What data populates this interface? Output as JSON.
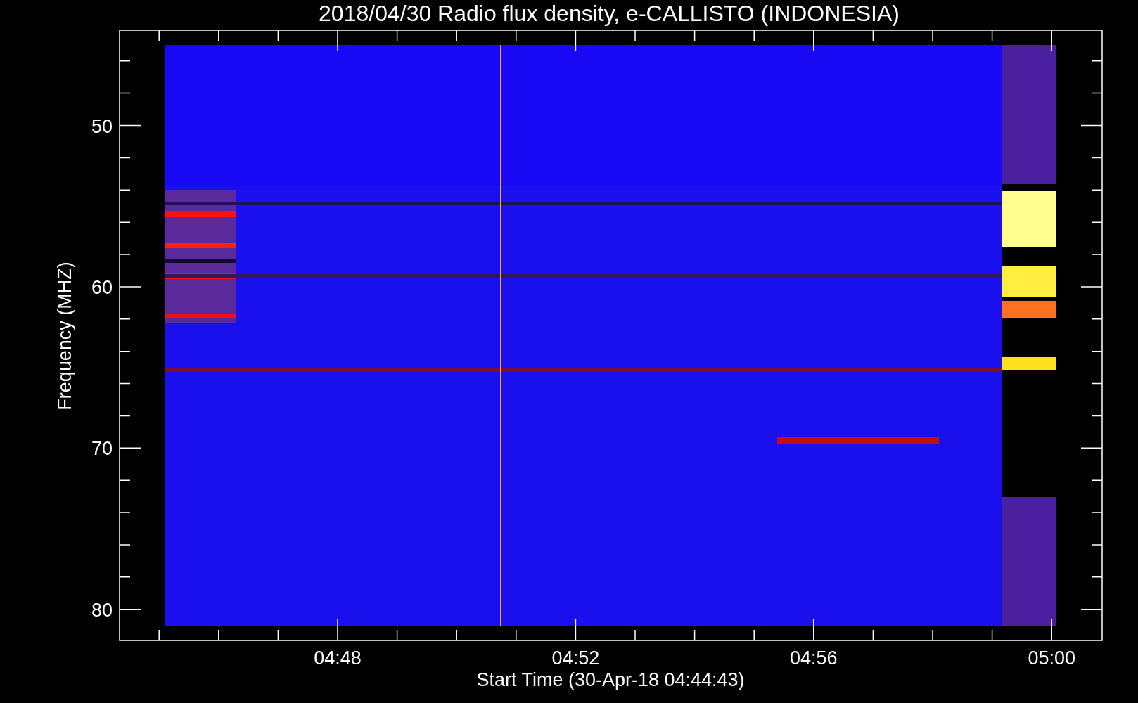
{
  "title": "2018/04/30  Radio flux density, e-CALLISTO (INDONESIA)",
  "y_axis": {
    "label": "Frequency (MHZ)",
    "ticks": [
      "50",
      "60",
      "70",
      "80"
    ]
  },
  "x_axis": {
    "label": "Start Time (30-Apr-18 04:44:43)",
    "ticks": [
      "04:48",
      "04:52",
      "04:56",
      "05:00"
    ]
  }
}
